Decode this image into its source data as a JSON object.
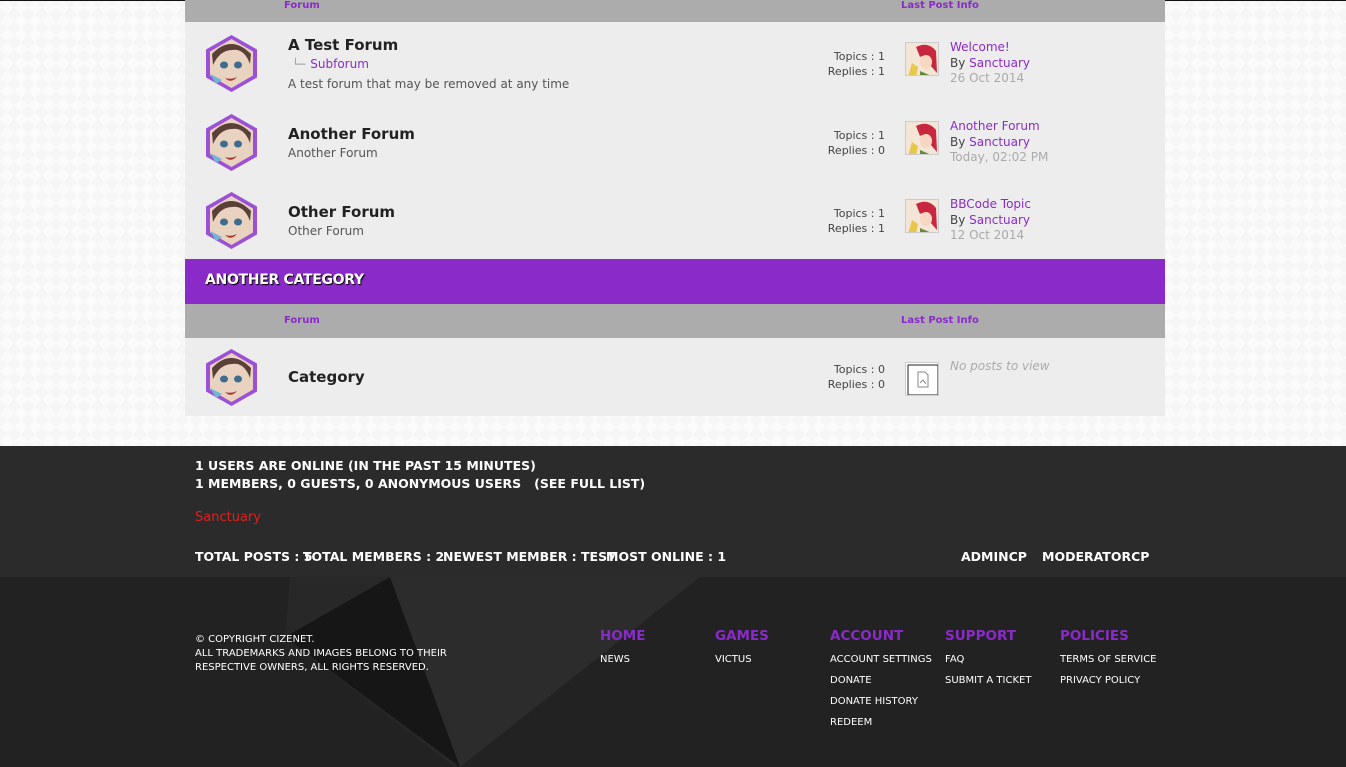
{
  "table1": {
    "header_forum": "Forum",
    "header_last": "Last Post Info",
    "forums": [
      {
        "title": "A Test Forum",
        "subforum": "Subforum",
        "description": "A test forum that may be removed at any time",
        "topics": "Topics : 1",
        "replies": "Replies : 1",
        "last_title": "Welcome!",
        "last_by_prefix": "By ",
        "last_by": "Sanctuary",
        "last_date": "26 Oct 2014"
      },
      {
        "title": "Another Forum",
        "description": "Another Forum",
        "topics": "Topics : 1",
        "replies": "Replies : 0",
        "last_title": "Another Forum",
        "last_by_prefix": "By ",
        "last_by": "Sanctuary",
        "last_date": "Today, 02:02 PM"
      },
      {
        "title": "Other Forum",
        "description": "Other Forum",
        "topics": "Topics : 1",
        "replies": "Replies : 1",
        "last_title": "BBCode Topic",
        "last_by_prefix": "By ",
        "last_by": "Sanctuary",
        "last_date": "12 Oct 2014"
      }
    ]
  },
  "category2": {
    "name": "ANOTHER CATEGORY",
    "header_forum": "Forum",
    "header_last": "Last Post Info",
    "forum": {
      "title": "Category",
      "topics": "Topics : 0",
      "replies": "Replies : 0",
      "no_posts": "No posts to view"
    }
  },
  "online": {
    "line1": "1 USERS ARE ONLINE (IN THE PAST 15 MINUTES)",
    "line2": "1 MEMBERS, 0 GUESTS, 0 ANONYMOUS USERS",
    "full_list": "(SEE FULL LIST)",
    "user": "Sanctuary",
    "total_posts": "TOTAL POSTS : 5",
    "total_members": "TOTAL MEMBERS : 2",
    "newest_member": "NEWEST MEMBER : TEST",
    "most_online": "MOST ONLINE : 1",
    "admincp": "ADMINCP",
    "modcp": "MODERATORCP"
  },
  "footer": {
    "copyright_1": "© COPYRIGHT CIZENET.",
    "copyright_2": "ALL TRADEMARKS AND IMAGES BELONG TO THEIR",
    "copyright_3": "RESPECTIVE OWNERS, ALL RIGHTS RESERVED.",
    "columns": [
      {
        "heading": "HOME",
        "links": [
          "NEWS"
        ]
      },
      {
        "heading": "GAMES",
        "links": [
          "VICTUS"
        ]
      },
      {
        "heading": "ACCOUNT",
        "links": [
          "ACCOUNT SETTINGS",
          "DONATE",
          "DONATE HISTORY",
          "REDEEM"
        ]
      },
      {
        "heading": "SUPPORT",
        "links": [
          "FAQ",
          "SUBMIT A TICKET"
        ]
      },
      {
        "heading": "POLICIES",
        "links": [
          "TERMS OF SERVICE",
          "PRIVACY POLICY"
        ]
      }
    ]
  },
  "colors": {
    "accent": "#8a2bc9",
    "row_bg": "#ededed",
    "header_bg": "#acacac",
    "online_bg": "#2b2b2b",
    "footer_bg": "#222222",
    "online_user": "#e21f1f"
  }
}
